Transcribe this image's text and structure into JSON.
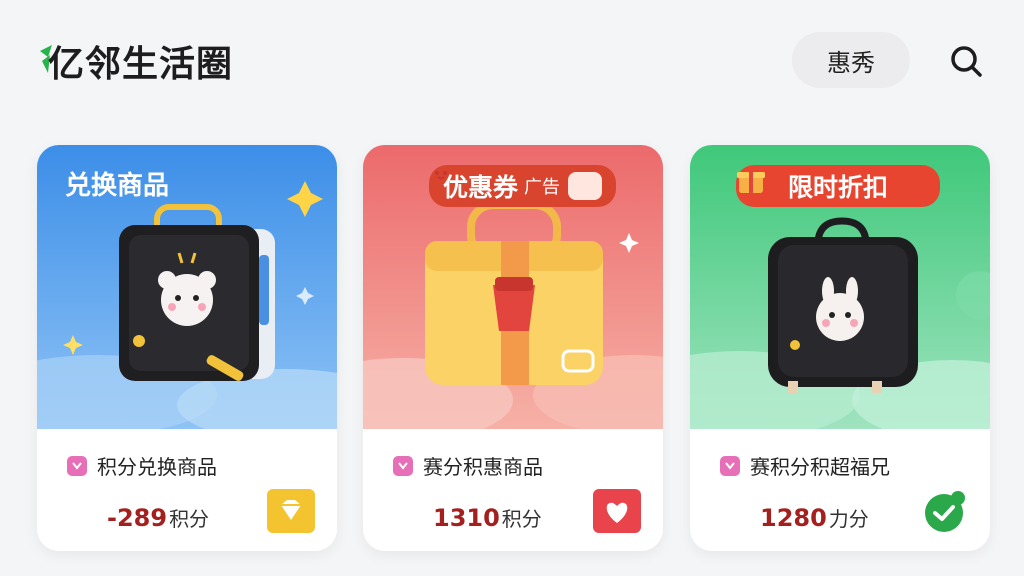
{
  "header": {
    "logo_text": "亿邻生活圈",
    "city_label": "惠秀",
    "search_icon": "search-icon"
  },
  "cards": [
    {
      "banner_title": "兑换商品",
      "name": "积分兑换商品",
      "price_value": "-289",
      "price_unit": "积分",
      "action_icon": "gem-icon",
      "accent": "#f4c430"
    },
    {
      "banner_title": "优惠券",
      "banner_extra": "广告",
      "name": "赛分积惠商品",
      "price_value": "1310",
      "price_unit": "积分",
      "action_icon": "heart-gift-icon",
      "accent": "#e9444b"
    },
    {
      "banner_title": "限时折扣",
      "name": "赛积分积超福兄",
      "price_value": "1280",
      "price_unit": "力分",
      "action_icon": "check-badge-icon",
      "accent": "#2aa84a"
    }
  ]
}
